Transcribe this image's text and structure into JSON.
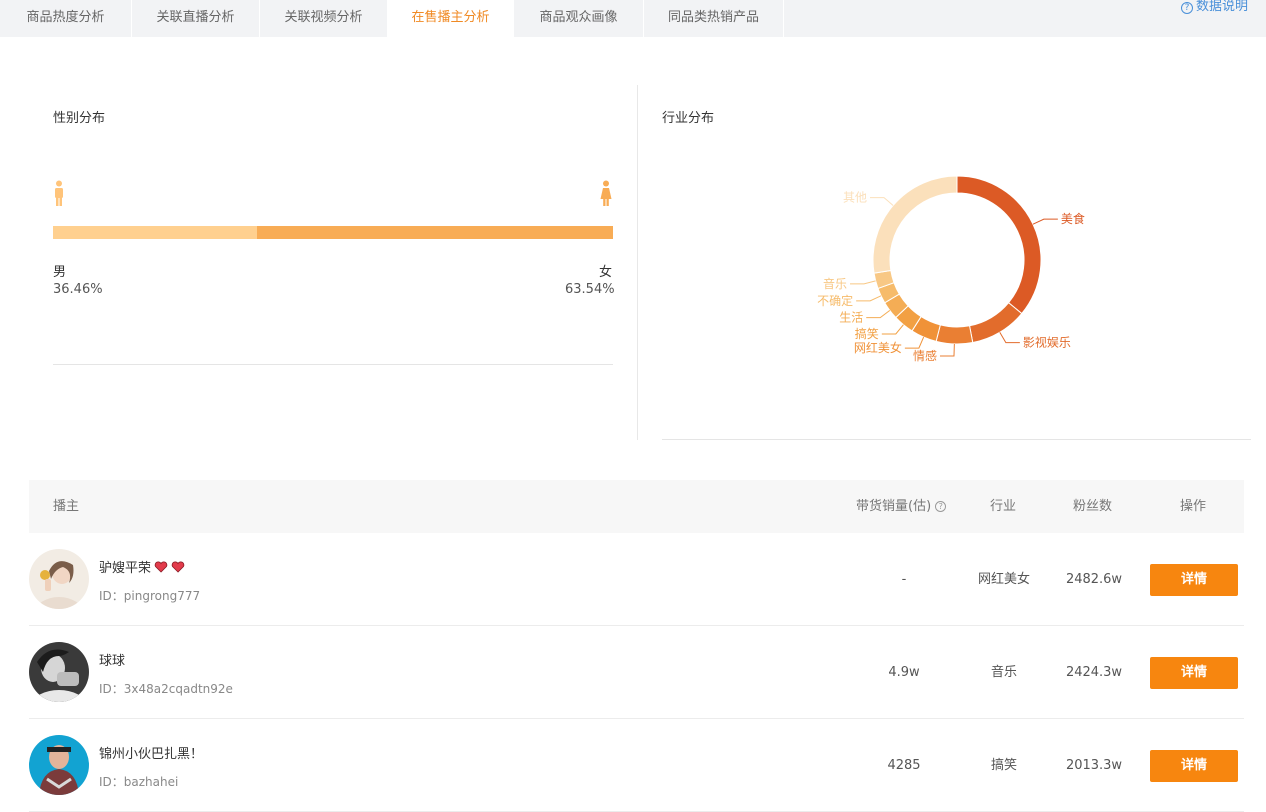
{
  "tabs": [
    {
      "label": "商品热度分析"
    },
    {
      "label": "关联直播分析"
    },
    {
      "label": "关联视频分析"
    },
    {
      "label": "在售播主分析"
    },
    {
      "label": "商品观众画像"
    },
    {
      "label": "同品类热销产品"
    }
  ],
  "help": {
    "label": "数据说明"
  },
  "gender": {
    "title": "性别分布",
    "male_label": "男",
    "female_label": "女",
    "male_pct": "36.46%",
    "female_pct": "63.54%",
    "male_fraction": 0.3646,
    "female_fraction": 0.6354,
    "male_color": "#ffd08f",
    "female_color": "#f8ac55"
  },
  "industry": {
    "title": "行业分布"
  },
  "chart_data": {
    "type": "pie",
    "title": "行业分布",
    "donut": true,
    "slices": [
      {
        "label": "美食",
        "value": 36,
        "color": "#dc5a25"
      },
      {
        "label": "影视娱乐",
        "value": 11,
        "color": "#e26c2c"
      },
      {
        "label": "情感",
        "value": 7,
        "color": "#ea7f33"
      },
      {
        "label": "网红美女",
        "value": 5,
        "color": "#f09238"
      },
      {
        "label": "搞笑",
        "value": 4,
        "color": "#f2a043"
      },
      {
        "label": "生活",
        "value": 3.5,
        "color": "#f4ad55"
      },
      {
        "label": "不确定",
        "value": 3,
        "color": "#f6bb6a"
      },
      {
        "label": "音乐",
        "value": 3,
        "color": "#f8c885"
      },
      {
        "label": "其他",
        "value": 27.5,
        "color": "#fbe0bb"
      }
    ]
  },
  "table": {
    "headers": {
      "anchor": "播主",
      "sales": "带货销量(估)",
      "industry": "行业",
      "fans": "粉丝数",
      "action": "操作"
    },
    "rows": [
      {
        "name": "驴嫂平荣",
        "id": "ID：pingrong777",
        "sales": "-",
        "industry": "网红美女",
        "fans": "2482.6w",
        "action": "详情"
      },
      {
        "name": "球球",
        "id": "ID：3x48a2cqadtn92e",
        "sales": "4.9w",
        "industry": "音乐",
        "fans": "2424.3w",
        "action": "详情"
      },
      {
        "name": "锦州小伙巴扎黑！",
        "id": "ID：bazhahei",
        "sales": "4285",
        "industry": "搞笑",
        "fans": "2013.3w",
        "action": "详情"
      }
    ]
  }
}
